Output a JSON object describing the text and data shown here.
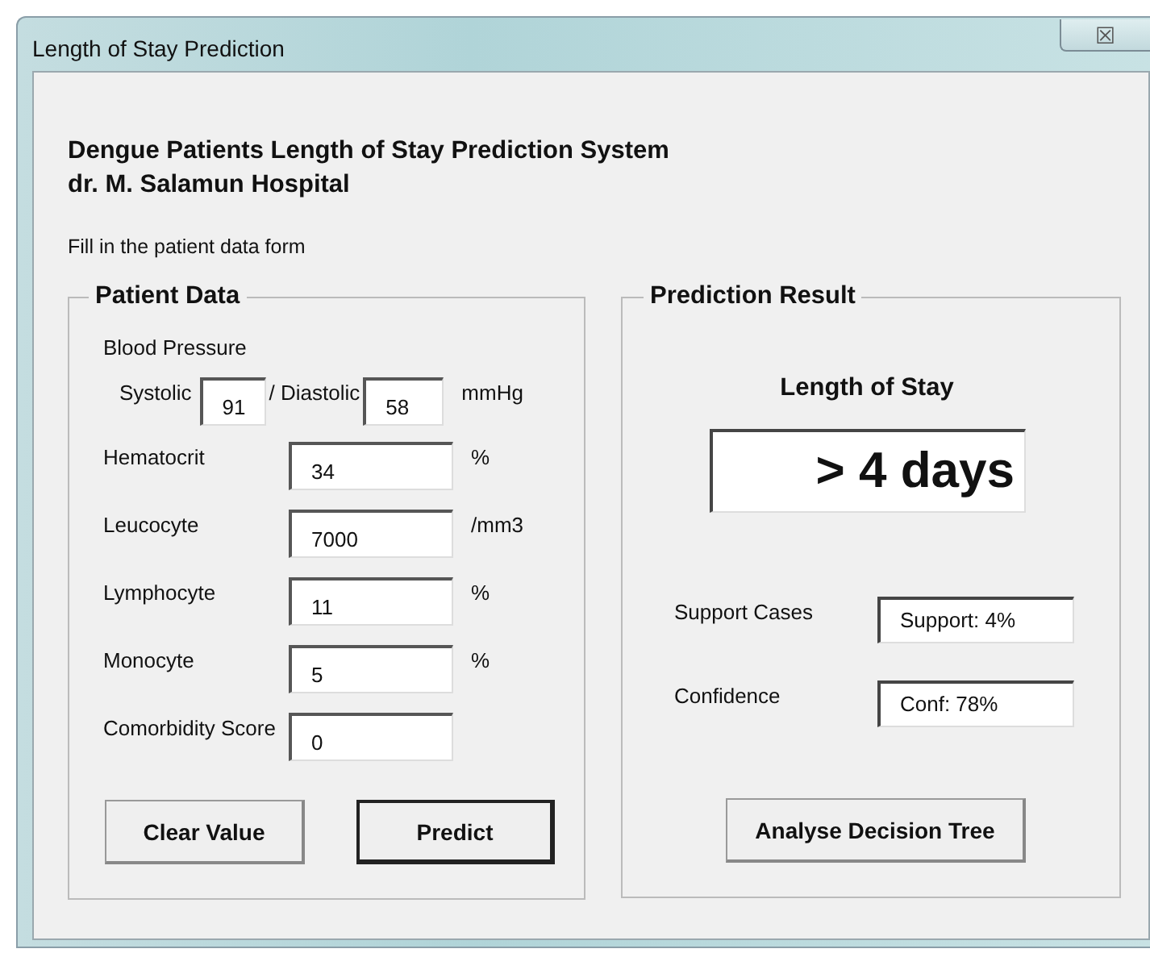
{
  "window": {
    "title": "Length of Stay Prediction",
    "close": "☒"
  },
  "heading": [
    "Dengue Patients Length of Stay Prediction System",
    "dr. M. Salamun Hospital"
  ],
  "instruction": "Fill in the patient data form",
  "patient_data": {
    "legend": "Patient Data",
    "blood_pressure": {
      "label": "Blood Pressure",
      "systolic_label": "Systolic",
      "systolic": "91",
      "diastolic_label": "/ Diastolic",
      "diastolic": "58",
      "unit": "mmHg"
    },
    "fields": [
      {
        "label": "Hematocrit",
        "value": "34",
        "unit": "%"
      },
      {
        "label": "Leucocyte",
        "value": "7000",
        "unit": "/mm3"
      },
      {
        "label": "Lymphocyte",
        "value": "11",
        "unit": "%"
      },
      {
        "label": "Monocyte",
        "value": "5",
        "unit": "%"
      },
      {
        "label": "Comorbidity Score",
        "value": "0"
      }
    ],
    "buttons": [
      {
        "label": "Clear Value",
        "default": false
      },
      {
        "label": "Predict",
        "default": true
      }
    ]
  },
  "prediction_result": {
    "legend": "Prediction Result",
    "title": "Length of Stay",
    "result": "> 4 days",
    "metrics": [
      {
        "label": "Support Cases",
        "value": "Support: 4%"
      },
      {
        "label": "Confidence",
        "value": "Conf: 78%"
      }
    ],
    "button": {
      "label": "Analyse Decision Tree",
      "default": false
    }
  }
}
